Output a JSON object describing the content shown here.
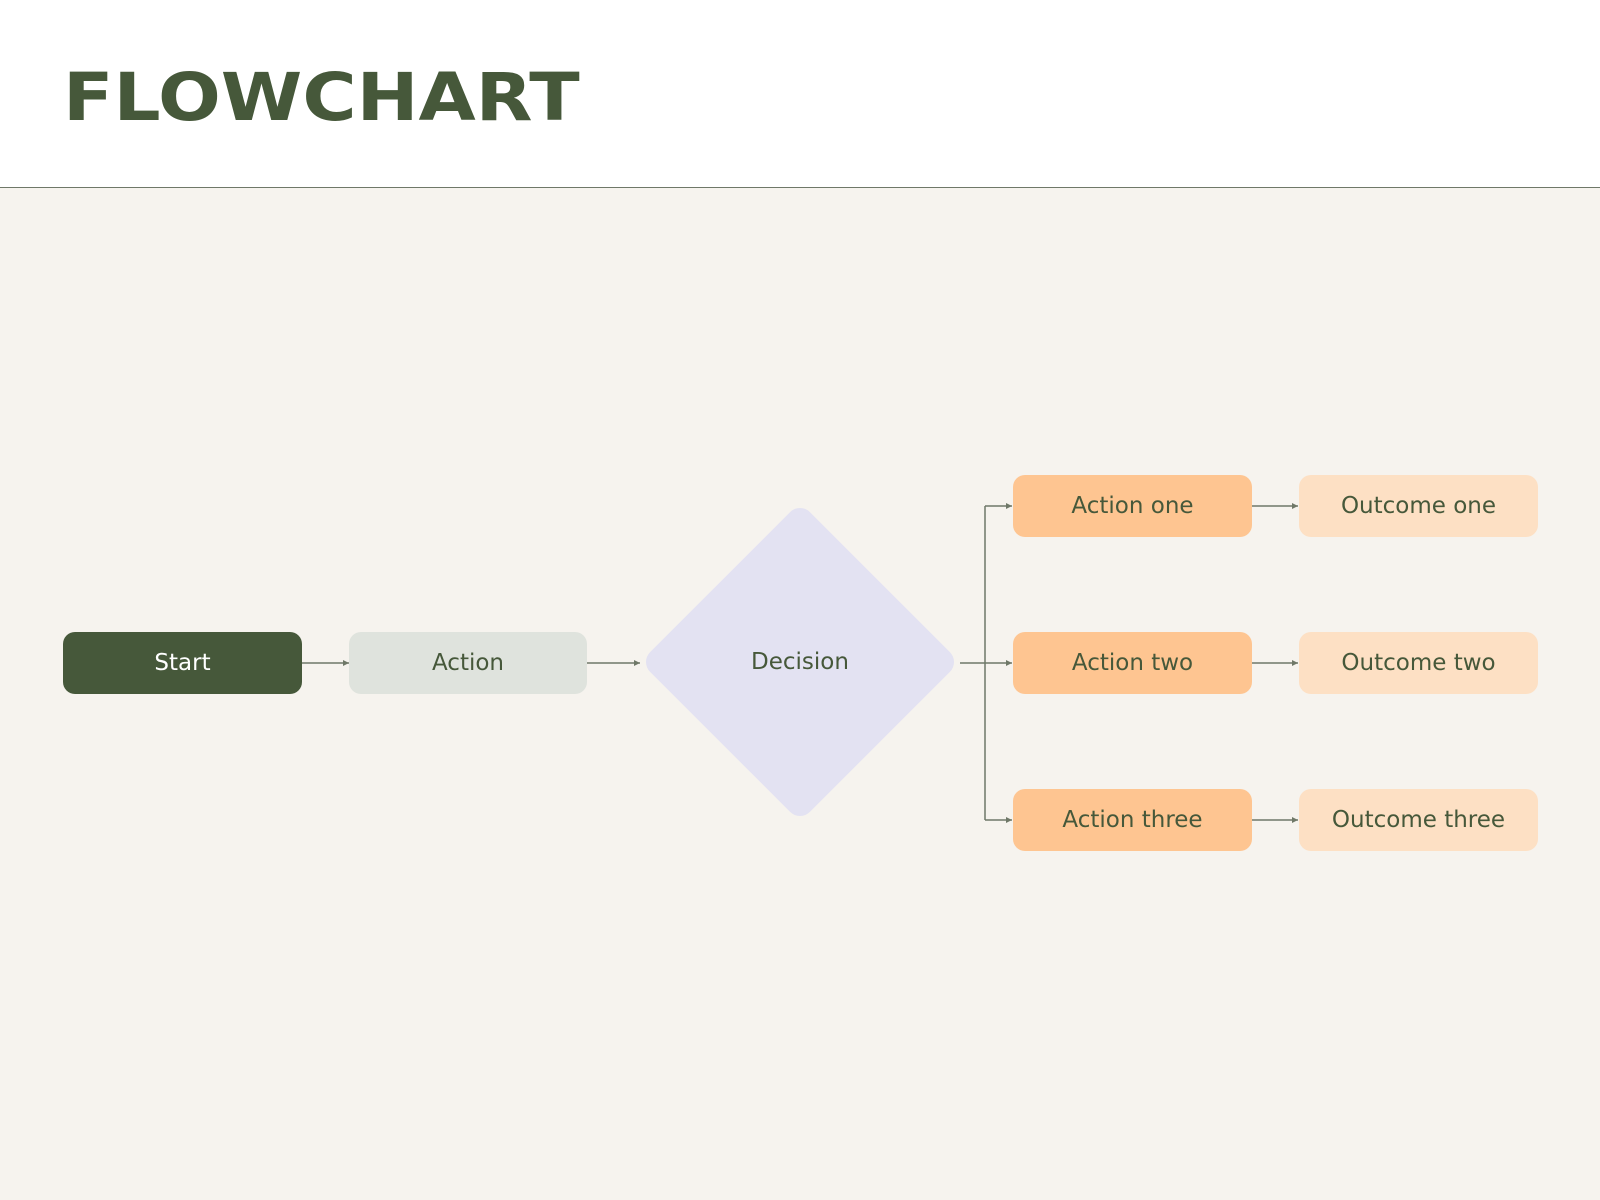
{
  "header": {
    "title": "FLOWCHART"
  },
  "colors": {
    "title": "#46583a",
    "header_bg": "#ffffff",
    "canvas_bg": "#f6f3ee",
    "start_fill": "#46583a",
    "action_fill": "#dfe3dd",
    "decision_fill": "#e3e2f2",
    "branch_fill": "#fec591",
    "outcome_fill": "#fde0c4",
    "connector": "#6f7868"
  },
  "flow": {
    "start": "Start",
    "action": "Action",
    "decision": "Decision",
    "branches": [
      {
        "action": "Action one",
        "outcome": "Outcome one"
      },
      {
        "action": "Action two",
        "outcome": "Outcome two"
      },
      {
        "action": "Action three",
        "outcome": "Outcome three"
      }
    ]
  },
  "connections": [
    {
      "from": "Start",
      "to": "Action"
    },
    {
      "from": "Action",
      "to": "Decision"
    },
    {
      "from": "Decision",
      "to": "Action one"
    },
    {
      "from": "Decision",
      "to": "Action two"
    },
    {
      "from": "Decision",
      "to": "Action three"
    },
    {
      "from": "Action one",
      "to": "Outcome one"
    },
    {
      "from": "Action two",
      "to": "Outcome two"
    },
    {
      "from": "Action three",
      "to": "Outcome three"
    }
  ]
}
